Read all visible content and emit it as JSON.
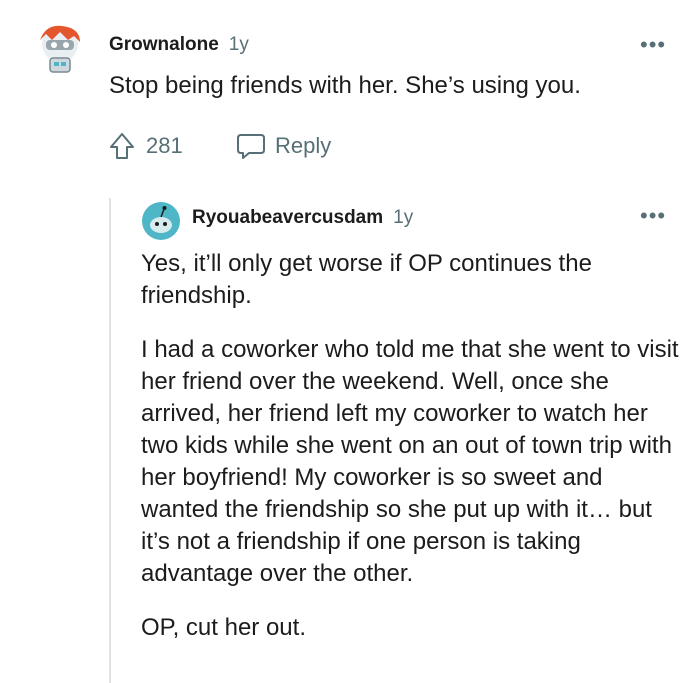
{
  "comment": {
    "author": "Grownalone",
    "age": "1y",
    "text": "Stop being friends with her. She’s using you.",
    "votes": "281",
    "reply_label": "Reply",
    "more_label": "•••"
  },
  "reply": {
    "author": "Ryouabeavercusdam",
    "age": "1y",
    "more_label": "•••",
    "paragraphs": [
      "Yes, it’ll only get worse if OP continues the friendship.",
      "I had a coworker who told me that she went to visit her friend over the weekend. Well, once she arrived, her friend left my coworker to watch her two kids while she went on an out of town trip with her boyfriend! My coworker is so sweet and wanted the friendship so she put up with it… but it’s not a friendship if one person is taking advantage over the other.",
      "OP, cut her out."
    ]
  },
  "colors": {
    "text": "#1c1c1c",
    "meta": "#576f76",
    "thread_line": "#dfe3e5",
    "avatar_teal": "#4fb6c7"
  },
  "icons": [
    "avatar-robot-icon",
    "upvote-icon",
    "reply-bubble-icon",
    "overflow-menu-icon"
  ]
}
